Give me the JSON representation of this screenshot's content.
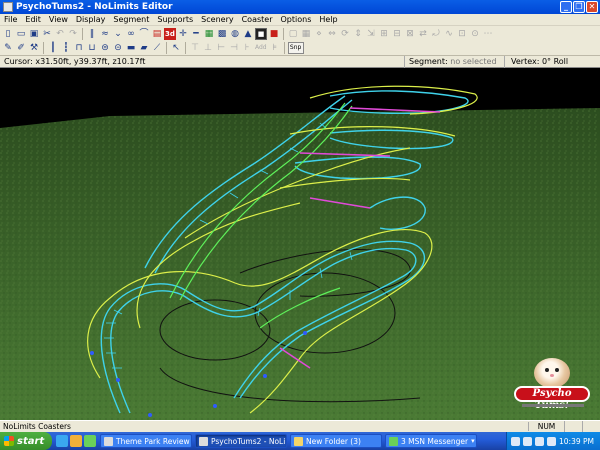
{
  "window": {
    "title": "PsychoTums2 - NoLimits Editor"
  },
  "menu": [
    "File",
    "Edit",
    "View",
    "Display",
    "Segment",
    "Supports",
    "Scenery",
    "Coaster",
    "Options",
    "Help"
  ],
  "toolbar": {
    "three_d_label": "3d",
    "add_label": "Add",
    "snap_label": "Snp"
  },
  "statusstrip": {
    "cursor": "Cursor: x31.50ft, y39.37ft, z10.17ft",
    "segment_label": "Segment:",
    "segment_value": "no selected",
    "vertex": "Vertex: 0° Roll"
  },
  "logo": {
    "text": "Psycho Tums!"
  },
  "appstatus": {
    "left": "NoLimits Coasters",
    "num": "NUM"
  },
  "taskbar": {
    "start": "start",
    "tasks": [
      {
        "label": "Theme Park Review :...",
        "active": false
      },
      {
        "label": "PsychoTums2 - NoLim...",
        "active": true
      },
      {
        "label": "New Folder (3)",
        "active": false
      },
      {
        "label": "3 MSN Messenger",
        "active": false
      }
    ],
    "clock": "10:39 PM"
  },
  "colors": {
    "sky": "#000000",
    "grass": "#3f6a2c",
    "track_cyan": "#3fd2ea",
    "track_yellow": "#dcef4a",
    "track_magenta": "#e04ad8",
    "track_green": "#5ef05a"
  }
}
